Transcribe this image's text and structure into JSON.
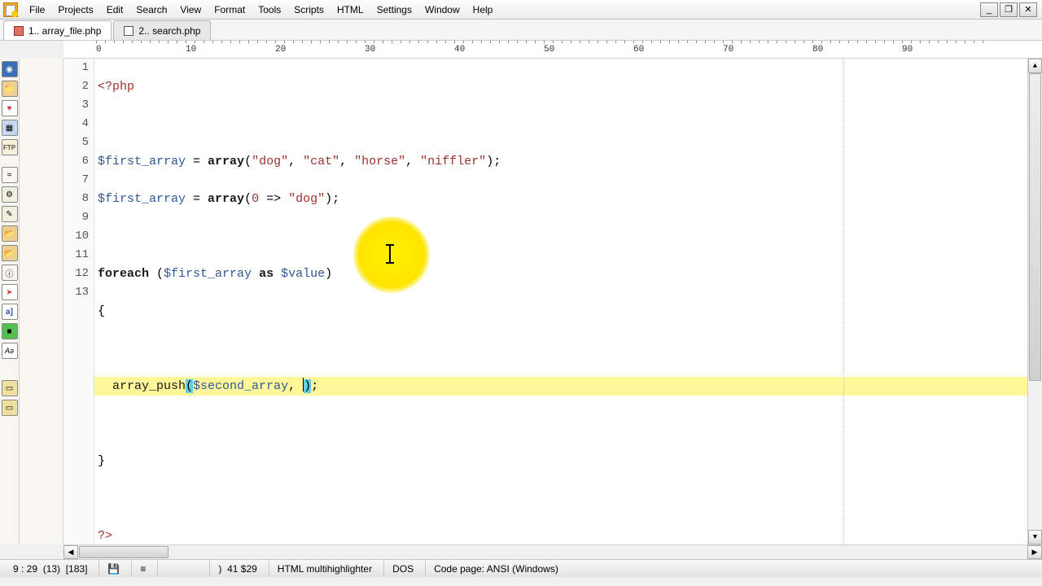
{
  "menu": {
    "file": "File",
    "projects": "Projects",
    "edit": "Edit",
    "search": "Search",
    "view": "View",
    "format": "Format",
    "tools": "Tools",
    "scripts": "Scripts",
    "html": "HTML",
    "settings": "Settings",
    "window": "Window",
    "help": "Help"
  },
  "win": {
    "min": "_",
    "max": "❐",
    "close": "✕"
  },
  "tabs": [
    {
      "label": "1.. array_file.php"
    },
    {
      "label": "2.. search.php"
    }
  ],
  "ruler": [
    "0",
    "10",
    "20",
    "30",
    "40",
    "50",
    "60",
    "70",
    "80",
    "90"
  ],
  "gutter": [
    "1",
    "2",
    "3",
    "4",
    "5",
    "6",
    "7",
    "8",
    "9",
    "10",
    "11",
    "12",
    "13"
  ],
  "code": {
    "l1_open": "<?php",
    "l3_var": "$first_array",
    "l3_eq": " = ",
    "l3_arr": "array",
    "l3_p1": "(",
    "l3_s1": "\"dog\"",
    "l3_c1": ", ",
    "l3_s2": "\"cat\"",
    "l3_c2": ", ",
    "l3_s3": "\"horse\"",
    "l3_c3": ", ",
    "l3_s4": "\"niffler\"",
    "l3_p2": ");",
    "l4_var": "$first_array",
    "l4_eq": " = ",
    "l4_arr": "array",
    "l4_p1": "(",
    "l4_n": "0",
    "l4_arw": " => ",
    "l4_s1": "\"dog\"",
    "l4_p2": ");",
    "l6_kw": "foreach",
    "l6_sp": " (",
    "l6_v1": "$first_array",
    "l6_as": " as ",
    "l6_v2": "$value",
    "l6_cp": ")",
    "l7": "{",
    "l9_fn": "array_push",
    "l9_po": "(",
    "l9_v": "$second_array",
    "l9_cm": ", ",
    "l9_pc": ")",
    "l9_sc": ";",
    "l11": "}",
    "l13": "?>"
  },
  "sidebar": {
    "ftp": "FTP",
    "eq": "=",
    "a": "a]",
    "ae": "Aə",
    "heart": "♥",
    "arrow": "➤"
  },
  "status": {
    "pos": "9 : 29",
    "paren": "(13)",
    "bytes": "[183]",
    "char": ")",
    "col": "41",
    "money": "$29",
    "mode": "HTML multihighlighter",
    "eol": "DOS",
    "encoding": "Code page: ANSI (Windows)",
    "save": "💾",
    "wrap": "≡"
  },
  "scroll": {
    "up": "▲",
    "down": "▼",
    "left": "◀",
    "right": "▶"
  }
}
